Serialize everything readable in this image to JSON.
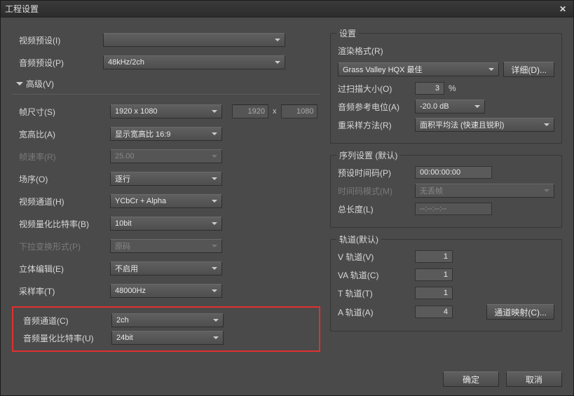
{
  "titlebar": {
    "title": "工程设置",
    "close": "✕"
  },
  "left": {
    "videoPresetLabel": "视频预设(I)",
    "videoPresetValue": "",
    "audioPresetLabel": "音频预设(P)",
    "audioPresetValue": "48kHz/2ch",
    "advancedLabel": "高级(V)",
    "frameSizeLabel": "帧尺寸(S)",
    "frameSizeValue": "1920 x 1080",
    "frameW": "1920",
    "frameH": "1080",
    "x": "x",
    "aspectLabel": "宽高比(A)",
    "aspectValue": "显示宽高比 16:9",
    "frameRateLabel": "帧速率(R)",
    "frameRateValue": "25.00",
    "fieldOrderLabel": "场序(O)",
    "fieldOrderValue": "逐行",
    "videoChannelLabel": "视频通道(H)",
    "videoChannelValue": "YCbCr + Alpha",
    "videoBitDepthLabel": "视频量化比特率(B)",
    "videoBitDepthValue": "10bit",
    "pulldownLabel": "下拉变换形式(P)",
    "pulldownValue": "原码",
    "stereoEditLabel": "立体编辑(E)",
    "stereoEditValue": "不启用",
    "sampleRateLabel": "采样率(T)",
    "sampleRateValue": "48000Hz",
    "audioChannelLabel": "音频通道(C)",
    "audioChannelValue": "2ch",
    "audioBitDepthLabel": "音频量化比特率(U)",
    "audioBitDepthValue": "24bit"
  },
  "right": {
    "settings": {
      "legend": "设置",
      "renderFormatLabel": "渲染格式(R)",
      "renderFormatValue": "Grass Valley HQX 最佳",
      "detailBtn": "详细(D)...",
      "overscanLabel": "过扫描大小(O)",
      "overscanValue": "3",
      "pct": "%",
      "audioRefLabel": "音频参考电位(A)",
      "audioRefValue": "-20.0 dB",
      "resampleLabel": "重采样方法(R)",
      "resampleValue": "面积平均法 (快速且锐利)"
    },
    "sequence": {
      "legend": "序列设置 (默认)",
      "presetTCLabel": "预设时间码(P)",
      "presetTCValue": "00:00:00:00",
      "tcModeLabel": "时间码模式(M)",
      "tcModeValue": "无丢帧",
      "totalLenLabel": "总长度(L)",
      "totalLenValue": "--:--:--:--"
    },
    "tracks": {
      "legend": "轨道(默认)",
      "vLabel": "V 轨道(V)",
      "vValue": "1",
      "vaLabel": "VA 轨道(C)",
      "vaValue": "1",
      "tLabel": "T 轨道(T)",
      "tValue": "1",
      "aLabel": "A 轨道(A)",
      "aValue": "4",
      "channelMapBtn": "通道映射(C)..."
    }
  },
  "footer": {
    "ok": "确定",
    "cancel": "取消"
  }
}
